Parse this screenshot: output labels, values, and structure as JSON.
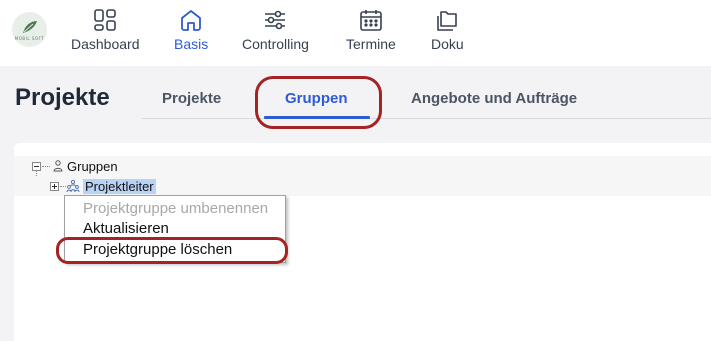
{
  "topnav": {
    "logo_text": "MOBIL SOFT",
    "items": [
      {
        "label": "Dashboard",
        "icon": "dashboard-icon"
      },
      {
        "label": "Basis",
        "icon": "home-icon",
        "active": true
      },
      {
        "label": "Controlling",
        "icon": "sliders-icon"
      },
      {
        "label": "Termine",
        "icon": "calendar-icon"
      },
      {
        "label": "Doku",
        "icon": "folders-icon"
      }
    ]
  },
  "page": {
    "title": "Projekte",
    "tabs": [
      {
        "label": "Projekte"
      },
      {
        "label": "Gruppen",
        "active": true
      },
      {
        "label": "Angebote und Aufträge"
      }
    ]
  },
  "tree": {
    "root": {
      "label": "Gruppen",
      "icon": "group-node-icon",
      "expanded": true
    },
    "children": [
      {
        "label": "Projektleiter",
        "icon": "users-node-icon",
        "selected": true,
        "expanded": false
      }
    ]
  },
  "context_menu": {
    "items": [
      {
        "label": "Projektgruppe umbenennen",
        "enabled": false
      },
      {
        "label": "Aktualisieren",
        "enabled": true
      },
      {
        "label": "Projektgruppe löschen",
        "enabled": true,
        "highlighted": true
      }
    ]
  },
  "colors": {
    "accent": "#2f5bd3",
    "highlight_ring": "#a42323",
    "selection": "#b9d3f7",
    "page_bg": "#f3f3f5"
  }
}
